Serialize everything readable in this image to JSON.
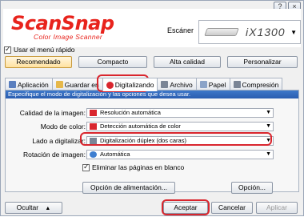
{
  "window": {
    "min_symbol": "?",
    "close_symbol": "×"
  },
  "header": {
    "logo": "ScanSnap",
    "logo_sub": "Color Image Scanner",
    "scanner_label": "Escáner",
    "scanner_model": "iX1300",
    "scanner_arrow": "▼"
  },
  "quick_menu": {
    "label": "Usar el menú rápido",
    "checked": true
  },
  "profiles": [
    "Recomendado",
    "Compacto",
    "Alta calidad",
    "Personalizar"
  ],
  "tabs": [
    {
      "label": "Aplicación",
      "icon": "application-icon",
      "color": "#5a7fbf"
    },
    {
      "label": "Guardar en",
      "icon": "folder-icon",
      "color": "#e6b84a"
    },
    {
      "label": "Digitalizando",
      "icon": "scanning-icon",
      "color": "#d9262e"
    },
    {
      "label": "Archivo",
      "icon": "file-icon",
      "color": "#7a8596"
    },
    {
      "label": "Papel",
      "icon": "paper-icon",
      "color": "#8aa3c8"
    },
    {
      "label": "Compresión",
      "icon": "compression-icon",
      "color": "#7a8596"
    }
  ],
  "panel": {
    "banner": "Especifique el modo de digitalización y las opciones que desea usar.",
    "fields": [
      {
        "label": "Calidad de la imagen:",
        "value": "Resolución automática",
        "icon_color": "#d9262e"
      },
      {
        "label": "Modo de color:",
        "value": "Detección automática de color",
        "icon_color": "#d9262e"
      },
      {
        "label": "Lado a digitalizar:",
        "value": "Digitalización dúplex (dos caras)",
        "icon_color": "#7a8596"
      },
      {
        "label": "Rotación de imagen:",
        "value": "Automática",
        "icon_color": "#3f7fd0"
      }
    ],
    "eliminate_blank": {
      "label": "Eliminar las páginas en blanco",
      "checked": true
    },
    "feed_option": "Opción de alimentación...",
    "option": "Opción..."
  },
  "footer": {
    "hide": "Ocultar",
    "hide_arrow": "▲",
    "ok": "Aceptar",
    "cancel": "Cancelar",
    "apply": "Aplicar"
  }
}
